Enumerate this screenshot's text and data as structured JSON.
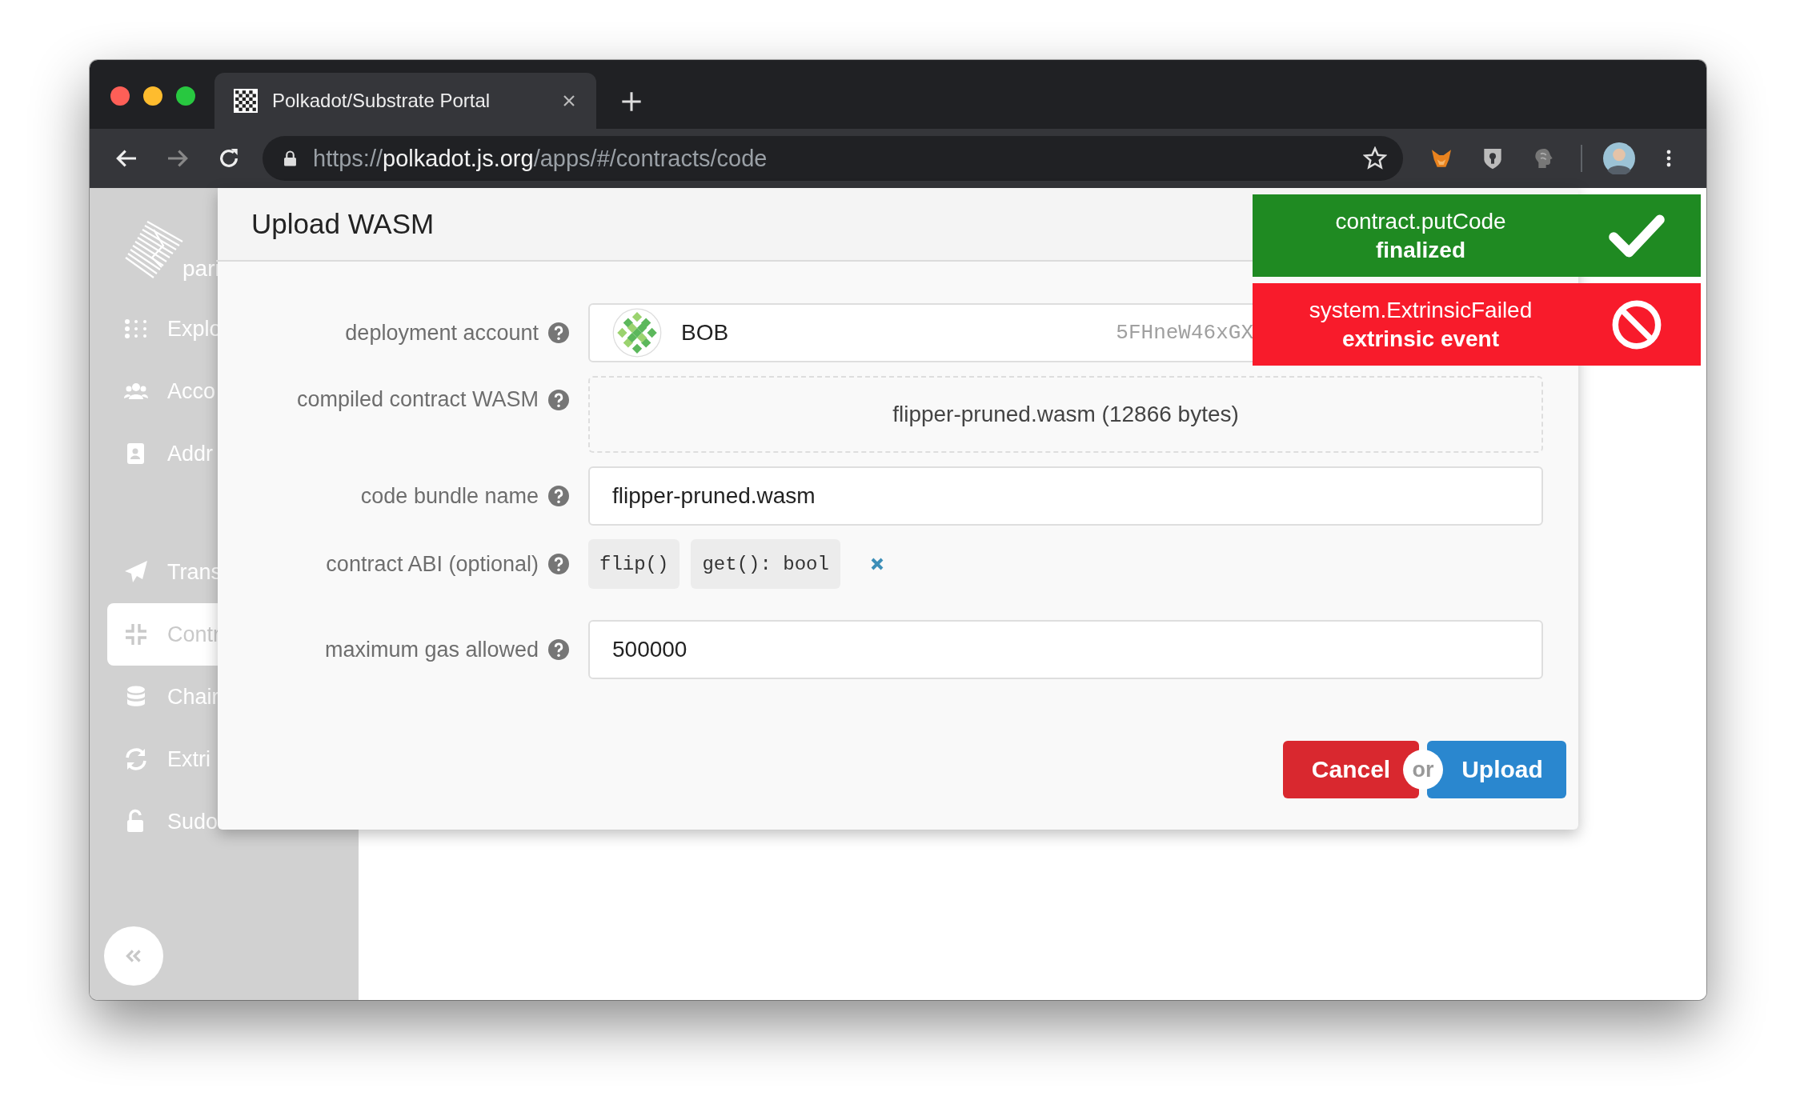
{
  "browser": {
    "tab_title": "Polkadot/Substrate Portal",
    "url_scheme": "https://",
    "url_host": "polkadot.js.org",
    "url_path": "/apps/#/contracts/code"
  },
  "sidebar": {
    "logo_text": "pari",
    "items": [
      {
        "label": "Explo",
        "selected": false
      },
      {
        "label": "Acco",
        "selected": false
      },
      {
        "label": "Addr",
        "selected": false
      },
      {
        "label": "Trans",
        "selected": false
      },
      {
        "label": "Contr",
        "selected": true
      },
      {
        "label": "Chair",
        "selected": false
      },
      {
        "label": "Extri",
        "selected": false
      },
      {
        "label": "Sudo",
        "selected": false
      }
    ]
  },
  "modal": {
    "title": "Upload WASM",
    "fields": [
      {
        "kind": "account",
        "label": "deployment account",
        "name": "BOB",
        "address": "5FHneW46xGX"
      },
      {
        "kind": "file",
        "label": "compiled contract WASM",
        "value": "flipper-pruned.wasm (12866 bytes)"
      },
      {
        "kind": "input",
        "label": "code bundle name",
        "value": "flipper-pruned.wasm"
      },
      {
        "kind": "abi",
        "label": "contract ABI (optional)",
        "messages": [
          "flip()",
          "get(): bool"
        ]
      },
      {
        "kind": "input",
        "label": "maximum gas allowed",
        "value": "500000"
      }
    ],
    "buttons": {
      "cancel": "Cancel",
      "separator": "or",
      "confirm": "Upload"
    }
  },
  "notifications": [
    {
      "kind": "success",
      "title": "contract.putCode",
      "status": "finalized"
    },
    {
      "kind": "error",
      "title": "system.ExtrinsicFailed",
      "status": "extrinsic event"
    }
  ]
}
